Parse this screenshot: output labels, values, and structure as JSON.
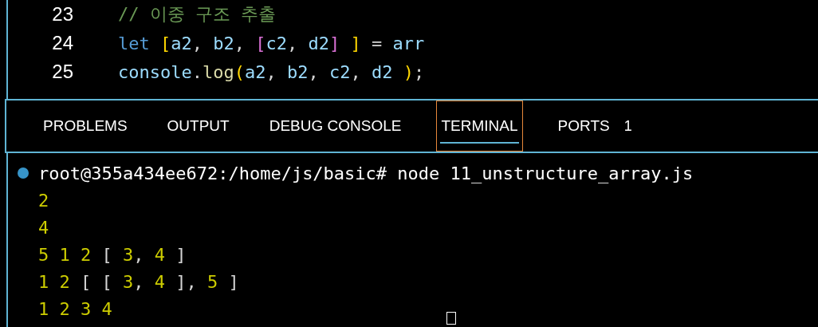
{
  "editor": {
    "lines": [
      {
        "number": "23",
        "tokens": [
          {
            "text": "// 이중 구조 추출",
            "kind": "comment"
          }
        ]
      },
      {
        "number": "24",
        "tokens": [
          {
            "text": "let ",
            "kind": "keyword"
          },
          {
            "text": "[",
            "kind": "bracket1"
          },
          {
            "text": "a2",
            "kind": "var"
          },
          {
            "text": ", ",
            "kind": "plain"
          },
          {
            "text": "b2",
            "kind": "var"
          },
          {
            "text": ", ",
            "kind": "plain"
          },
          {
            "text": "[",
            "kind": "bracket2"
          },
          {
            "text": "c2",
            "kind": "var"
          },
          {
            "text": ", ",
            "kind": "plain"
          },
          {
            "text": "d2",
            "kind": "var"
          },
          {
            "text": "]",
            "kind": "bracket2"
          },
          {
            "text": " ]",
            "kind": "bracket1"
          },
          {
            "text": " = ",
            "kind": "plain"
          },
          {
            "text": "arr",
            "kind": "var"
          }
        ]
      },
      {
        "number": "25",
        "tokens": [
          {
            "text": "console",
            "kind": "var"
          },
          {
            "text": ".",
            "kind": "plain"
          },
          {
            "text": "log",
            "kind": "function"
          },
          {
            "text": "(",
            "kind": "bracket1"
          },
          {
            "text": "a2",
            "kind": "var"
          },
          {
            "text": ", ",
            "kind": "plain"
          },
          {
            "text": "b2",
            "kind": "var"
          },
          {
            "text": ", ",
            "kind": "plain"
          },
          {
            "text": "c2",
            "kind": "var"
          },
          {
            "text": ", ",
            "kind": "plain"
          },
          {
            "text": "d2 ",
            "kind": "var"
          },
          {
            "text": ")",
            "kind": "bracket1"
          },
          {
            "text": ";",
            "kind": "plain"
          }
        ]
      }
    ]
  },
  "panel": {
    "tabs": [
      {
        "label": "PROBLEMS",
        "selected": false
      },
      {
        "label": "OUTPUT",
        "selected": false
      },
      {
        "label": "DEBUG CONSOLE",
        "selected": false
      },
      {
        "label": "TERMINAL",
        "selected": true
      },
      {
        "label": "PORTS",
        "selected": false,
        "badge": "1"
      }
    ]
  },
  "terminal": {
    "prompt": "root@355a434ee672:/home/js/basic# node 11_unstructure_array.js",
    "output": [
      [
        {
          "text": "2",
          "kind": "num"
        }
      ],
      [
        {
          "text": "4",
          "kind": "num"
        }
      ],
      [
        {
          "text": "5 1 2",
          "kind": "num"
        },
        {
          "text": " [ ",
          "kind": "plain"
        },
        {
          "text": "3",
          "kind": "num"
        },
        {
          "text": ", ",
          "kind": "plain"
        },
        {
          "text": "4",
          "kind": "num"
        },
        {
          "text": " ]",
          "kind": "plain"
        }
      ],
      [
        {
          "text": "1 2",
          "kind": "num"
        },
        {
          "text": " [ [ ",
          "kind": "plain"
        },
        {
          "text": "3",
          "kind": "num"
        },
        {
          "text": ", ",
          "kind": "plain"
        },
        {
          "text": "4",
          "kind": "num"
        },
        {
          "text": " ], ",
          "kind": "plain"
        },
        {
          "text": "5",
          "kind": "num"
        },
        {
          "text": " ]",
          "kind": "plain"
        }
      ],
      [
        {
          "text": "1 2 3 4",
          "kind": "num"
        }
      ]
    ]
  }
}
